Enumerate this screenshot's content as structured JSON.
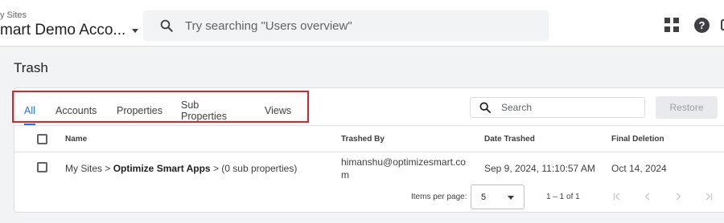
{
  "header": {
    "account_crumb": "y Sites",
    "account_name": "mart Demo Acco...",
    "search_placeholder": "Try searching \"Users overview\""
  },
  "page": {
    "title": "Trash"
  },
  "tabs": [
    {
      "label": "All",
      "active": true
    },
    {
      "label": "Accounts",
      "active": false
    },
    {
      "label": "Properties",
      "active": false
    },
    {
      "label": "Sub Properties",
      "active": false
    },
    {
      "label": "Views",
      "active": false
    }
  ],
  "table_toolbar": {
    "search_placeholder": "Search",
    "restore_label": "Restore"
  },
  "table": {
    "columns": [
      "Name",
      "Trashed By",
      "Date Trashed",
      "Final Deletion"
    ],
    "rows": [
      {
        "name_prefix": "My Sites > ",
        "name_bold": "Optimize Smart Apps",
        "name_suffix": " > (0 sub properties)",
        "trashed_by": "himanshu@optimizesmart.com",
        "date_trashed": "Sep 9, 2024, 11:10:57 AM",
        "final_deletion": "Oct 14, 2024"
      }
    ]
  },
  "pagination": {
    "items_per_page_label": "Items per page:",
    "items_per_page_value": "5",
    "range_text": "1 – 1 of 1"
  },
  "colors": {
    "accent": "#1a73e8",
    "highlight_box": "#e01f26",
    "background": "#f1f3f4"
  }
}
